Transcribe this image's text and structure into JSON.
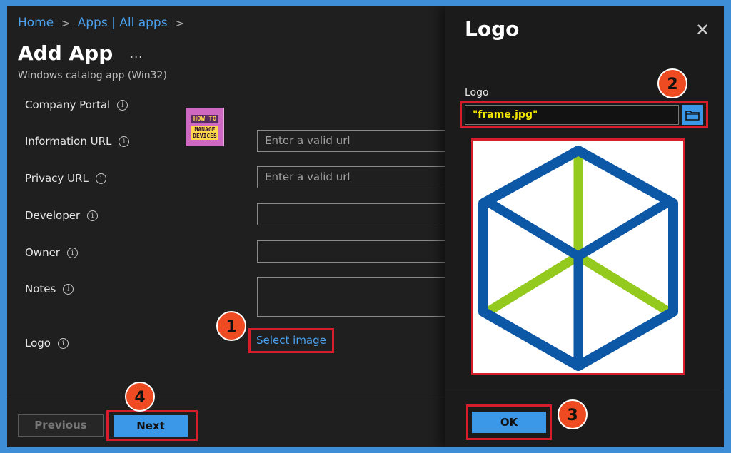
{
  "breadcrumb": {
    "home": "Home",
    "separator": ">",
    "apps": "Apps | All apps"
  },
  "page": {
    "title": "Add App",
    "more": "...",
    "subtitle": "Windows catalog app (Win32)"
  },
  "form": {
    "company_portal": "Company Portal",
    "information_url": {
      "label": "Information URL",
      "placeholder": "Enter a valid url"
    },
    "privacy_url": {
      "label": "Privacy URL",
      "placeholder": "Enter a valid url"
    },
    "developer": {
      "label": "Developer"
    },
    "owner": {
      "label": "Owner"
    },
    "notes": {
      "label": "Notes"
    },
    "logo": {
      "label": "Logo",
      "select_image": "Select image"
    },
    "info_glyph": "i"
  },
  "badge": {
    "line1": "HOW TO",
    "line2": "MANAGE\nDEVICES"
  },
  "footer": {
    "previous": "Previous",
    "next": "Next"
  },
  "panel": {
    "title": "Logo",
    "close": "✕",
    "label": "Logo",
    "file_value": "\"frame.jpg\"",
    "ok": "OK"
  },
  "callouts": [
    "1",
    "2",
    "3",
    "4"
  ],
  "colors": {
    "accent": "#3b97e8",
    "link": "#4aa0ec",
    "highlight": "#d51d2b",
    "callout": "#ef4b22",
    "hex_blue": "#0d57a7",
    "hex_green": "#94c91e"
  },
  "icons": {
    "info": "info-icon",
    "close": "close-icon",
    "browse": "folder-icon",
    "more": "more-icon",
    "logo_preview": "cube-icon"
  }
}
